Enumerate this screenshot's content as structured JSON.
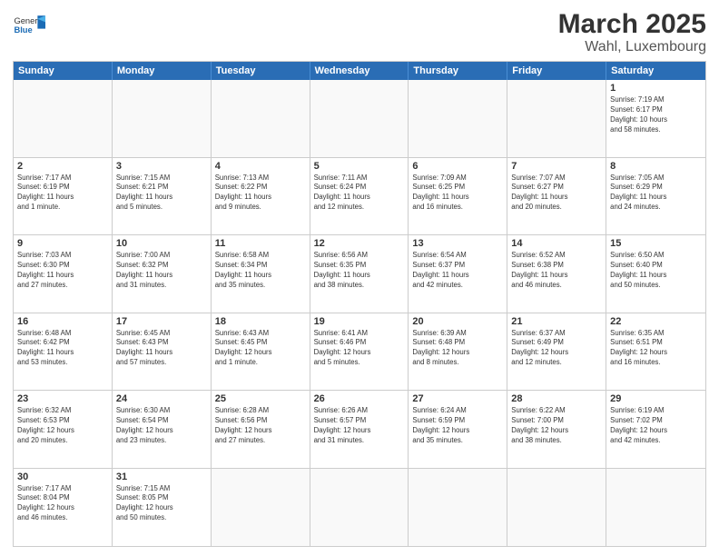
{
  "header": {
    "logo_text_normal": "General",
    "logo_text_blue": "Blue",
    "title": "March 2025",
    "subtitle": "Wahl, Luxembourg"
  },
  "days_of_week": [
    "Sunday",
    "Monday",
    "Tuesday",
    "Wednesday",
    "Thursday",
    "Friday",
    "Saturday"
  ],
  "weeks": [
    [
      {
        "day": "",
        "info": ""
      },
      {
        "day": "",
        "info": ""
      },
      {
        "day": "",
        "info": ""
      },
      {
        "day": "",
        "info": ""
      },
      {
        "day": "",
        "info": ""
      },
      {
        "day": "",
        "info": ""
      },
      {
        "day": "1",
        "info": "Sunrise: 7:19 AM\nSunset: 6:17 PM\nDaylight: 10 hours\nand 58 minutes."
      }
    ],
    [
      {
        "day": "2",
        "info": "Sunrise: 7:17 AM\nSunset: 6:19 PM\nDaylight: 11 hours\nand 1 minute."
      },
      {
        "day": "3",
        "info": "Sunrise: 7:15 AM\nSunset: 6:21 PM\nDaylight: 11 hours\nand 5 minutes."
      },
      {
        "day": "4",
        "info": "Sunrise: 7:13 AM\nSunset: 6:22 PM\nDaylight: 11 hours\nand 9 minutes."
      },
      {
        "day": "5",
        "info": "Sunrise: 7:11 AM\nSunset: 6:24 PM\nDaylight: 11 hours\nand 12 minutes."
      },
      {
        "day": "6",
        "info": "Sunrise: 7:09 AM\nSunset: 6:25 PM\nDaylight: 11 hours\nand 16 minutes."
      },
      {
        "day": "7",
        "info": "Sunrise: 7:07 AM\nSunset: 6:27 PM\nDaylight: 11 hours\nand 20 minutes."
      },
      {
        "day": "8",
        "info": "Sunrise: 7:05 AM\nSunset: 6:29 PM\nDaylight: 11 hours\nand 24 minutes."
      }
    ],
    [
      {
        "day": "9",
        "info": "Sunrise: 7:03 AM\nSunset: 6:30 PM\nDaylight: 11 hours\nand 27 minutes."
      },
      {
        "day": "10",
        "info": "Sunrise: 7:00 AM\nSunset: 6:32 PM\nDaylight: 11 hours\nand 31 minutes."
      },
      {
        "day": "11",
        "info": "Sunrise: 6:58 AM\nSunset: 6:34 PM\nDaylight: 11 hours\nand 35 minutes."
      },
      {
        "day": "12",
        "info": "Sunrise: 6:56 AM\nSunset: 6:35 PM\nDaylight: 11 hours\nand 38 minutes."
      },
      {
        "day": "13",
        "info": "Sunrise: 6:54 AM\nSunset: 6:37 PM\nDaylight: 11 hours\nand 42 minutes."
      },
      {
        "day": "14",
        "info": "Sunrise: 6:52 AM\nSunset: 6:38 PM\nDaylight: 11 hours\nand 46 minutes."
      },
      {
        "day": "15",
        "info": "Sunrise: 6:50 AM\nSunset: 6:40 PM\nDaylight: 11 hours\nand 50 minutes."
      }
    ],
    [
      {
        "day": "16",
        "info": "Sunrise: 6:48 AM\nSunset: 6:42 PM\nDaylight: 11 hours\nand 53 minutes."
      },
      {
        "day": "17",
        "info": "Sunrise: 6:45 AM\nSunset: 6:43 PM\nDaylight: 11 hours\nand 57 minutes."
      },
      {
        "day": "18",
        "info": "Sunrise: 6:43 AM\nSunset: 6:45 PM\nDaylight: 12 hours\nand 1 minute."
      },
      {
        "day": "19",
        "info": "Sunrise: 6:41 AM\nSunset: 6:46 PM\nDaylight: 12 hours\nand 5 minutes."
      },
      {
        "day": "20",
        "info": "Sunrise: 6:39 AM\nSunset: 6:48 PM\nDaylight: 12 hours\nand 8 minutes."
      },
      {
        "day": "21",
        "info": "Sunrise: 6:37 AM\nSunset: 6:49 PM\nDaylight: 12 hours\nand 12 minutes."
      },
      {
        "day": "22",
        "info": "Sunrise: 6:35 AM\nSunset: 6:51 PM\nDaylight: 12 hours\nand 16 minutes."
      }
    ],
    [
      {
        "day": "23",
        "info": "Sunrise: 6:32 AM\nSunset: 6:53 PM\nDaylight: 12 hours\nand 20 minutes."
      },
      {
        "day": "24",
        "info": "Sunrise: 6:30 AM\nSunset: 6:54 PM\nDaylight: 12 hours\nand 23 minutes."
      },
      {
        "day": "25",
        "info": "Sunrise: 6:28 AM\nSunset: 6:56 PM\nDaylight: 12 hours\nand 27 minutes."
      },
      {
        "day": "26",
        "info": "Sunrise: 6:26 AM\nSunset: 6:57 PM\nDaylight: 12 hours\nand 31 minutes."
      },
      {
        "day": "27",
        "info": "Sunrise: 6:24 AM\nSunset: 6:59 PM\nDaylight: 12 hours\nand 35 minutes."
      },
      {
        "day": "28",
        "info": "Sunrise: 6:22 AM\nSunset: 7:00 PM\nDaylight: 12 hours\nand 38 minutes."
      },
      {
        "day": "29",
        "info": "Sunrise: 6:19 AM\nSunset: 7:02 PM\nDaylight: 12 hours\nand 42 minutes."
      }
    ],
    [
      {
        "day": "30",
        "info": "Sunrise: 7:17 AM\nSunset: 8:04 PM\nDaylight: 12 hours\nand 46 minutes."
      },
      {
        "day": "31",
        "info": "Sunrise: 7:15 AM\nSunset: 8:05 PM\nDaylight: 12 hours\nand 50 minutes."
      },
      {
        "day": "",
        "info": ""
      },
      {
        "day": "",
        "info": ""
      },
      {
        "day": "",
        "info": ""
      },
      {
        "day": "",
        "info": ""
      },
      {
        "day": "",
        "info": ""
      }
    ]
  ]
}
